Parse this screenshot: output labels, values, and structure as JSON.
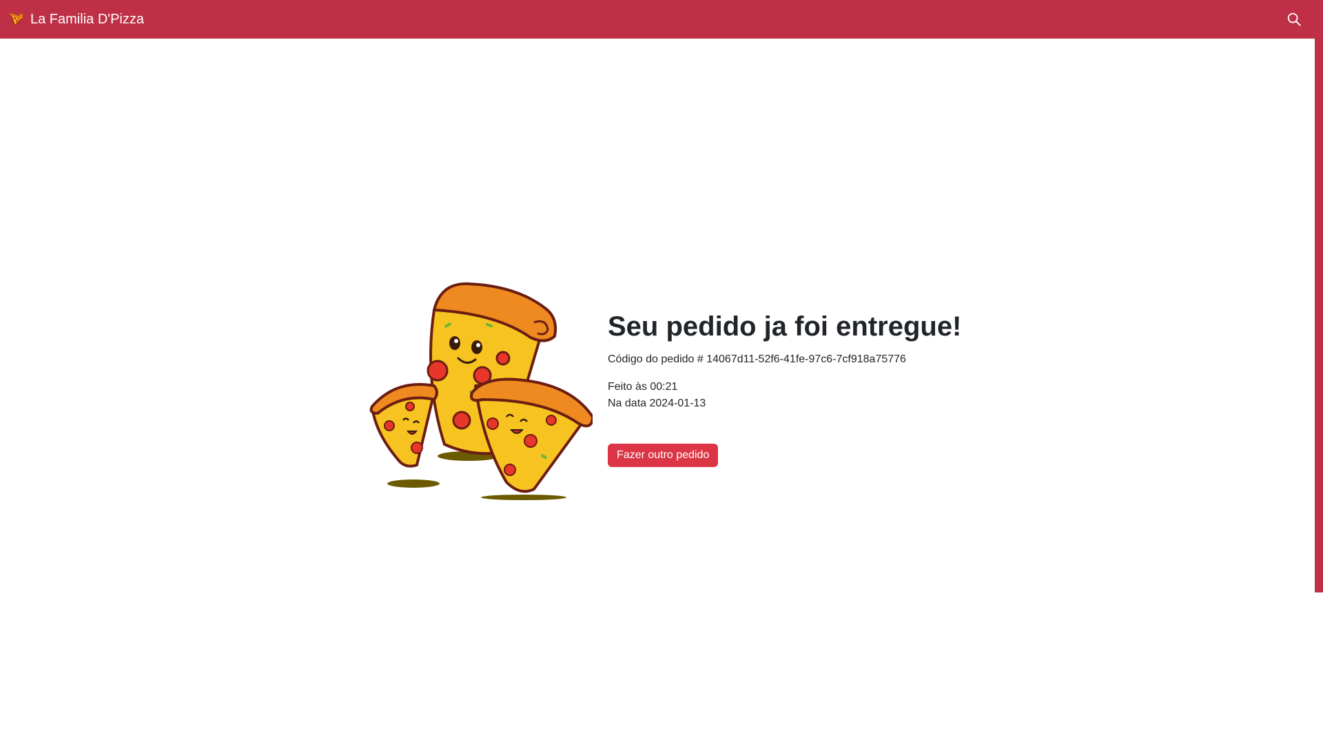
{
  "navbar": {
    "brand": "La Familia D'Pizza",
    "brand_icon": "pizza-slice-icon",
    "search_icon": "search-icon",
    "color": "#bf2f45"
  },
  "order": {
    "title": "Seu pedido ja foi entregue!",
    "code_text": "Código do pedido # 14067d11-52f6-41fe-97c6-7cf918a75776",
    "time_text": "Feito às 00:21",
    "date_text": "Na data 2024-01-13",
    "button_label": "Fazer outro pedido",
    "button_color": "#dc3545"
  },
  "illustration": "three-pizza-slices-cartoon"
}
